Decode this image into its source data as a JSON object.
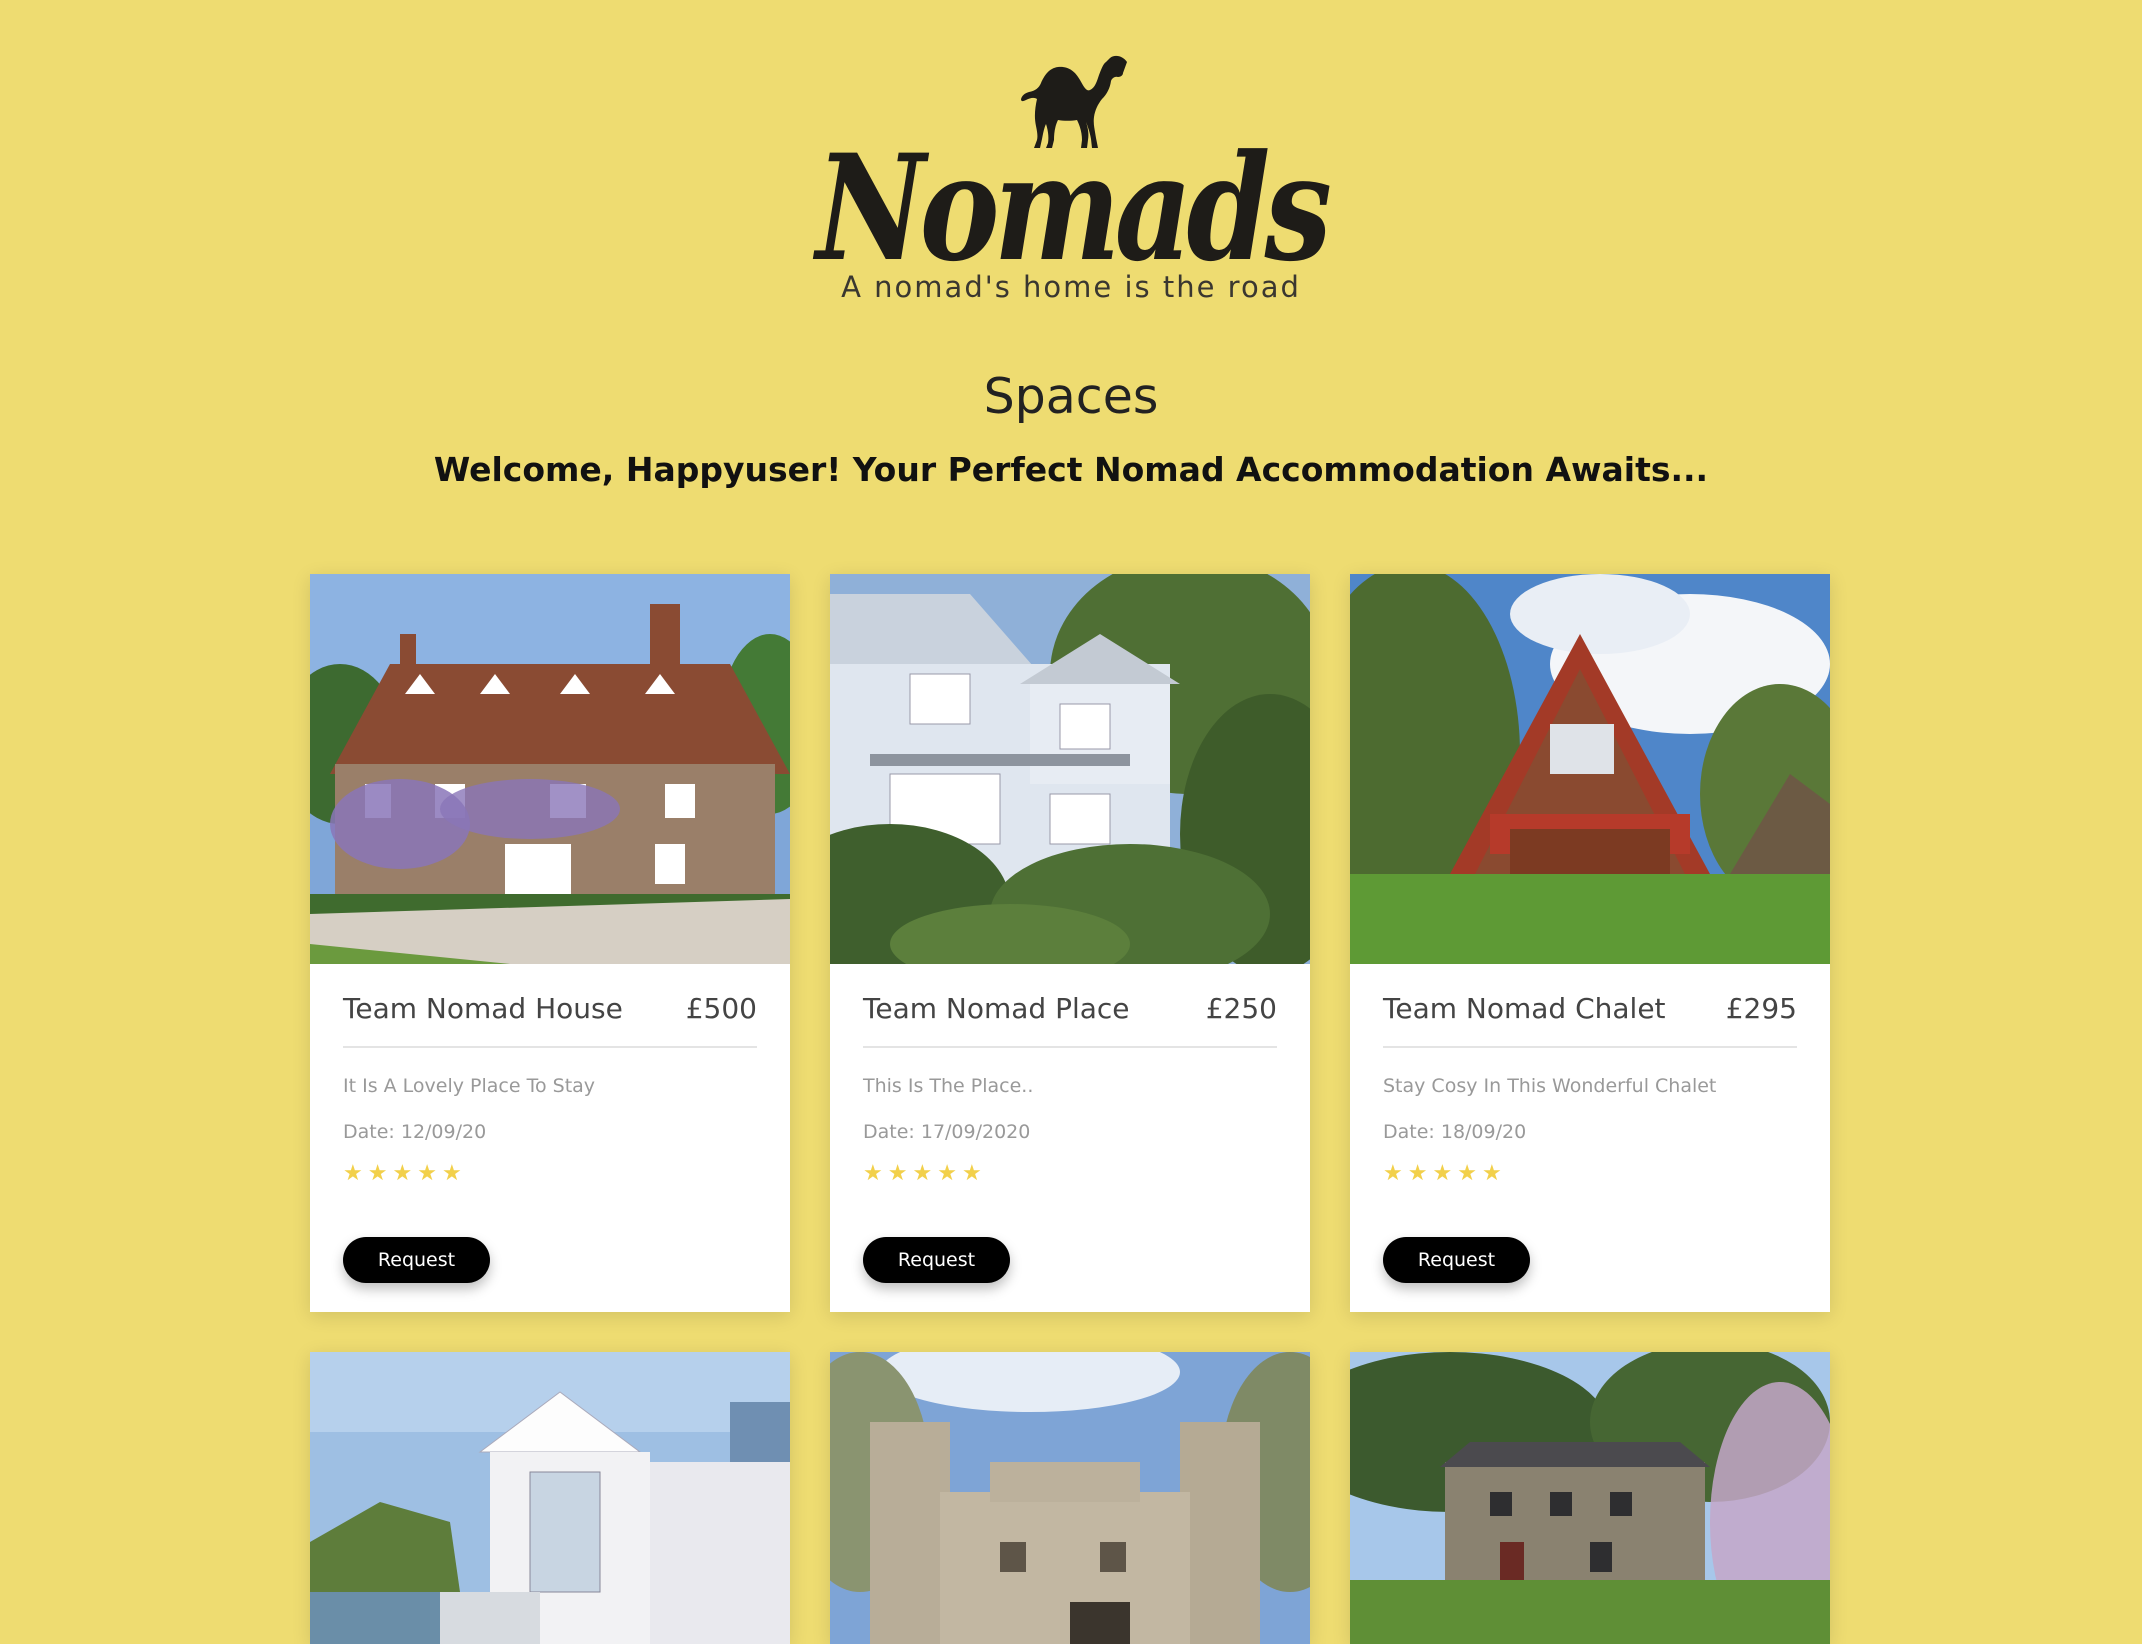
{
  "brand": {
    "name": "Nomads",
    "tagline": "A nomad's home is the road"
  },
  "page": {
    "heading": "Spaces",
    "welcome": "Welcome, Happyuser! Your Perfect Nomad Accommodation Awaits..."
  },
  "colors": {
    "background": "#eedc71",
    "star": "#f2d04a",
    "button": "#000000"
  },
  "spaces": [
    {
      "name": "Team Nomad House",
      "price": "£500",
      "description": "It Is A Lovely Place To Stay",
      "date": "Date: 12/09/20",
      "rating": 5,
      "button": "Request",
      "photo": "brick-manor-with-wisteria"
    },
    {
      "name": "Team Nomad Place",
      "price": "£250",
      "description": "This Is The Place..",
      "date": "Date: 17/09/2020",
      "rating": 5,
      "button": "Request",
      "photo": "white-house-with-garden"
    },
    {
      "name": "Team Nomad Chalet",
      "price": "£295",
      "description": "Stay Cosy In This Wonderful Chalet",
      "date": "Date: 18/09/20",
      "rating": 5,
      "button": "Request",
      "photo": "a-frame-chalet"
    },
    {
      "photo": "beach-hut"
    },
    {
      "photo": "castle"
    },
    {
      "photo": "stone-cottage"
    }
  ]
}
